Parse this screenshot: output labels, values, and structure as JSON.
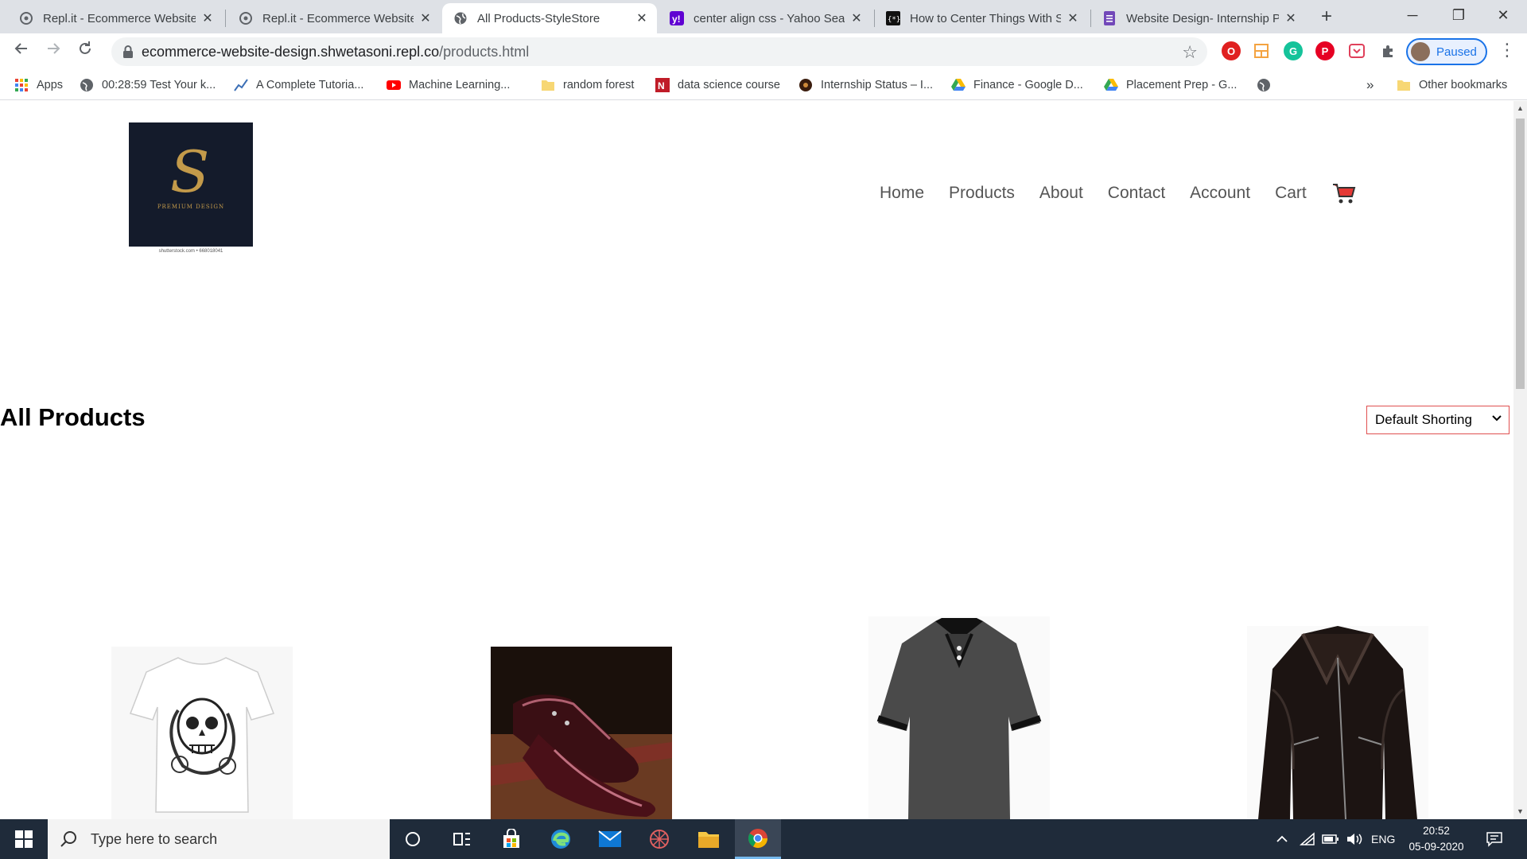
{
  "browser": {
    "tabs": [
      {
        "title": "Repl.it - Ecommerce Website",
        "active": false
      },
      {
        "title": "Repl.it - Ecommerce Website",
        "active": false
      },
      {
        "title": "All Products-StyleStore",
        "active": true
      },
      {
        "title": "center align css - Yahoo Search",
        "active": false
      },
      {
        "title": "How to Center Things With Style",
        "active": false
      },
      {
        "title": "Website Design- Internship Program",
        "active": false
      }
    ],
    "close_glyph": "✕",
    "new_tab_glyph": "+",
    "window_controls": {
      "minimize": "─",
      "maximize": "❐",
      "close": "✕"
    },
    "url_host": "ecommerce-website-design.shwetasoni.repl.co",
    "url_path": "/products.html",
    "profile_label": "Paused",
    "bookmarks": [
      {
        "label": "Apps"
      },
      {
        "label": "00:28:59 Test Your k..."
      },
      {
        "label": "A Complete Tutoria..."
      },
      {
        "label": "Machine Learning..."
      },
      {
        "label": "random forest"
      },
      {
        "label": "data science course"
      },
      {
        "label": "Internship Status – I..."
      },
      {
        "label": "Finance - Google D..."
      },
      {
        "label": "Placement Prep - G..."
      }
    ],
    "bookmarks_overflow": "»",
    "other_bookmarks": "Other bookmarks"
  },
  "site": {
    "logo_letter": "S",
    "logo_text": "PREMIUM DESIGN",
    "logo_caption": "shutterstock.com • 668018041",
    "nav": [
      "Home",
      "Products",
      "About",
      "Contact",
      "Account",
      "Cart"
    ],
    "heading": "All Products",
    "sort_selected": "Default Shorting"
  },
  "products": [
    {
      "name": "skull-tshirt"
    },
    {
      "name": "leather-shoes"
    },
    {
      "name": "polo-shirt"
    },
    {
      "name": "leather-jacket"
    }
  ],
  "taskbar": {
    "search_placeholder": "Type here to search",
    "language": "ENG",
    "time": "20:52",
    "date": "05-09-2020"
  }
}
